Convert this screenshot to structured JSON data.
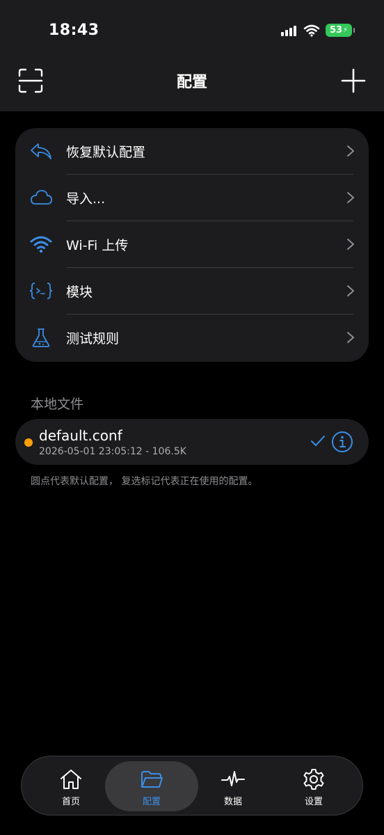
{
  "status": {
    "time": "18:43",
    "battery": "53"
  },
  "nav": {
    "title": "配置"
  },
  "menu": [
    {
      "label": "恢复默认配置",
      "icon": "undo-arrow-icon"
    },
    {
      "label": "导入...",
      "icon": "cloud-icon"
    },
    {
      "label": "Wi-Fi 上传",
      "icon": "wifi-icon"
    },
    {
      "label": "模块",
      "icon": "code-braces-icon"
    },
    {
      "label": "测试规则",
      "icon": "flask-icon"
    }
  ],
  "local_files": {
    "section_title": "本地文件",
    "files": [
      {
        "name": "default.conf",
        "meta": "2026-05-01 23:05:12 - 106.5K"
      }
    ],
    "footnote": "圆点代表默认配置， 复选标记代表正在使用的配置。"
  },
  "tabs": [
    {
      "label": "首页",
      "icon": "home-icon"
    },
    {
      "label": "配置",
      "icon": "folder-icon",
      "active": true
    },
    {
      "label": "数据",
      "icon": "pulse-icon"
    },
    {
      "label": "设置",
      "icon": "gear-icon"
    }
  ],
  "colors": {
    "accent": "#3a8ee6",
    "dot": "#ff9f0a",
    "battery": "#34c759"
  }
}
